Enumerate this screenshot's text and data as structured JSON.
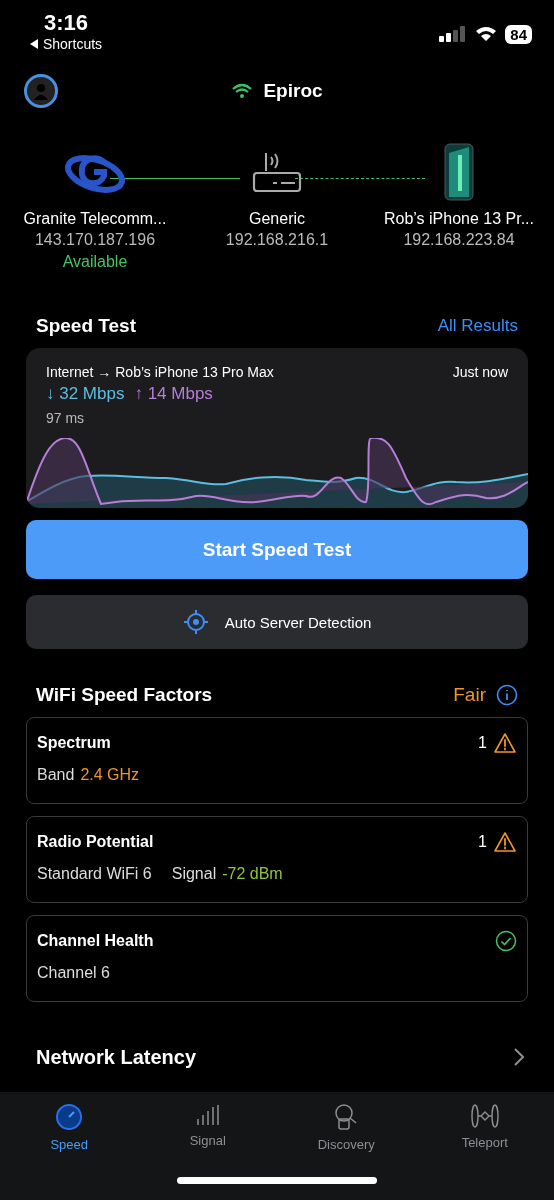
{
  "status_bar": {
    "time": "3:16",
    "back": "Shortcuts",
    "battery": "84"
  },
  "network": {
    "name": "Epiroc"
  },
  "topology": {
    "nodes": [
      {
        "kind": "isp",
        "name": "Granite Telecomm...",
        "ip": "143.170.187.196",
        "status": "Available"
      },
      {
        "kind": "router",
        "name": "Generic",
        "ip": "192.168.216.1"
      },
      {
        "kind": "phone",
        "name": "Rob’s iPhone 13 Pr...",
        "ip": "192.168.223.84"
      }
    ],
    "links": [
      {
        "kind": "solid"
      },
      {
        "kind": "dashed"
      }
    ]
  },
  "speed_test": {
    "title": "Speed Test",
    "link": "All Results",
    "route": "Internet → Rob’s iPhone 13 Pro Max",
    "time": "Just now",
    "download": "↓ 32 Mbps",
    "upload": "↑ 14 Mbps",
    "latency": "97 ms"
  },
  "start_button": "Start Speed Test",
  "server_button": "Auto Server Detection",
  "factors": {
    "title": "WiFi Speed Factors",
    "rating": "Fair",
    "items": [
      {
        "title": "Spectrum",
        "count": "1",
        "kind": "warning",
        "fields": [
          {
            "label": "Band",
            "value": "2.4 GHz",
            "color": "#f0952e"
          }
        ]
      },
      {
        "title": "Radio Potential",
        "count": "1",
        "kind": "warning",
        "fields": [
          {
            "label": "Standard WiFi 6"
          },
          {
            "label": "Signal",
            "value": "-72 dBm",
            "color": "#8dc63f"
          }
        ]
      },
      {
        "title": "Channel Health",
        "kind": "ok",
        "fields": [
          {
            "label": "Channel 6"
          }
        ]
      }
    ]
  },
  "latency_row": "Network Latency",
  "tabs": [
    {
      "kind": "speed",
      "label": "Speed",
      "selected": true
    },
    {
      "kind": "signal",
      "label": "Signal",
      "selected": false
    },
    {
      "kind": "discovery",
      "label": "Discovery",
      "selected": false
    },
    {
      "kind": "teleport",
      "label": "Teleport",
      "selected": false
    }
  ]
}
